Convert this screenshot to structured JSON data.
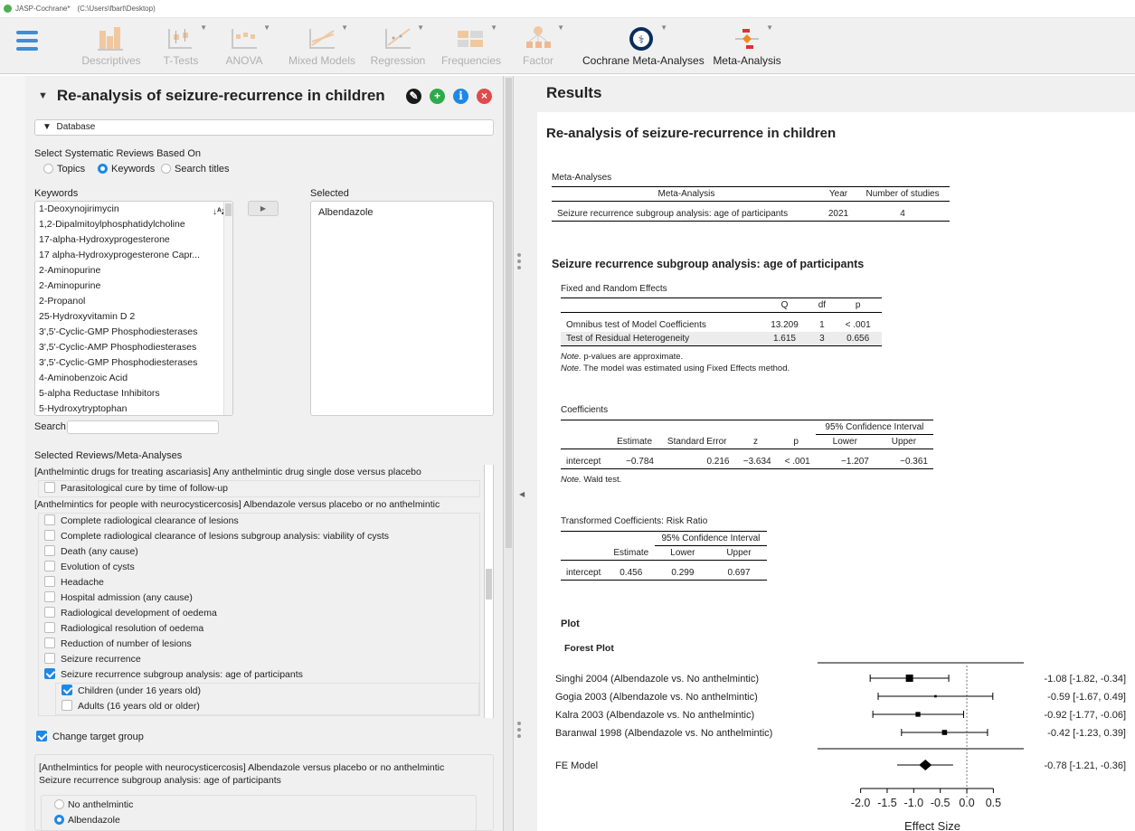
{
  "window": {
    "title": "JASP-Cochrane*",
    "path": "(C:\\Users\\fbart\\Desktop)"
  },
  "ribbon": {
    "modules": [
      {
        "label": "Descriptives",
        "active": false
      },
      {
        "label": "T-Tests",
        "active": false
      },
      {
        "label": "ANOVA",
        "active": false
      },
      {
        "label": "Mixed Models",
        "active": false
      },
      {
        "label": "Regression",
        "active": false
      },
      {
        "label": "Frequencies",
        "active": false
      },
      {
        "label": "Factor",
        "active": false
      },
      {
        "label": "Cochrane Meta-Analyses",
        "active": true
      },
      {
        "label": "Meta-Analysis",
        "active": true
      }
    ]
  },
  "analysis": {
    "title": "Re-analysis of seizure-recurrence in children",
    "database_label": "Database",
    "select_label": "Select Systematic Reviews Based On",
    "radio_options": [
      "Topics",
      "Keywords",
      "Search titles"
    ],
    "radio_selected": "Keywords",
    "keywords_label": "Keywords",
    "selected_label": "Selected",
    "keywords": [
      "1-Deoxynojirimycin",
      "1,2-Dipalmitoylphosphatidylcholine",
      "17-alpha-Hydroxyprogesterone",
      "17 alpha-Hydroxyprogesterone Capr...",
      "2-Aminopurine",
      "2-Aminopurine",
      "2-Propanol",
      "25-Hydroxyvitamin D 2",
      "3',5'-Cyclic-GMP Phosphodiesterases",
      "3',5'-Cyclic-AMP Phosphodiesterases",
      "3',5'-Cyclic-GMP Phosphodiesterases",
      "4-Aminobenzoic Acid",
      "5-alpha Reductase Inhibitors",
      "5-Hydroxytryptophan"
    ],
    "selected_keywords": [
      "Albendazole"
    ],
    "search_label": "Search",
    "reviews_label": "Selected Reviews/Meta-Analyses",
    "review1_header": "[Anthelmintic drugs for treating ascariasis] Any anthelmintic drug single dose versus placebo",
    "review1_items": [
      "Parasitological cure by time of follow-up"
    ],
    "review2_header": "[Anthelmintics for people with neurocysticercosis] Albendazole versus placebo or no anthelmintic",
    "review2_items": [
      {
        "label": "Complete radiological clearance of lesions",
        "checked": false
      },
      {
        "label": "Complete radiological clearance of lesions subgroup analysis: viability of cysts",
        "checked": false
      },
      {
        "label": "Death (any cause)",
        "checked": false
      },
      {
        "label": "Evolution of cysts",
        "checked": false
      },
      {
        "label": "Headache",
        "checked": false
      },
      {
        "label": "Hospital admission (any cause)",
        "checked": false
      },
      {
        "label": "Radiological development of oedema",
        "checked": false
      },
      {
        "label": "Radiological resolution of oedema",
        "checked": false
      },
      {
        "label": "Reduction of number of lesions",
        "checked": false
      },
      {
        "label": "Seizure recurrence",
        "checked": false
      },
      {
        "label": "Seizure recurrence subgroup analysis: age of participants",
        "checked": true
      }
    ],
    "subgroups": [
      {
        "label": "Children (under 16 years old)",
        "checked": true
      },
      {
        "label": "Adults (16 years old or older)",
        "checked": false
      }
    ],
    "change_target_label": "Change target group",
    "target_review": "[Anthelmintics for people with neurocysticercosis] Albendazole versus placebo or no anthelmintic",
    "target_outcome": "Seizure recurrence subgroup analysis: age of participants",
    "target_options": [
      "No anthelmintic",
      "Albendazole"
    ],
    "target_selected": "Albendazole"
  },
  "results": {
    "header": "Results",
    "title": "Re-analysis of seizure-recurrence in children",
    "ma_table": {
      "title": "Meta-Analyses",
      "headers": [
        "Meta-Analysis",
        "Year",
        "Number of studies"
      ],
      "row": [
        "Seizure recurrence subgroup analysis: age of participants",
        "2021",
        "4"
      ]
    },
    "section_title": "Seizure recurrence subgroup analysis: age of participants",
    "fre_table": {
      "title": "Fixed and Random Effects",
      "headers": [
        "",
        "Q",
        "df",
        "p"
      ],
      "rows": [
        [
          "Omnibus test of Model Coefficients",
          "13.209",
          "1",
          "< .001"
        ],
        [
          "Test of Residual Heterogeneity",
          "1.615",
          "3",
          "0.656"
        ]
      ],
      "note1_label": "Note.",
      "note1_rest": " p-values are approximate.",
      "note1_p": "p",
      "note2_label": "Note.",
      "note2_rest": " The model was estimated using Fixed Effects method."
    },
    "coef_table": {
      "title": "Coefficients",
      "ci_header": "95% Confidence Interval",
      "headers": [
        "",
        "Estimate",
        "Standard Error",
        "z",
        "p",
        "Lower",
        "Upper"
      ],
      "row": [
        "intercept",
        "−0.784",
        "0.216",
        "−3.634",
        "< .001",
        "−1.207",
        "−0.361"
      ],
      "note_label": "Note.",
      "note_rest": " Wald test."
    },
    "rr_table": {
      "title": "Transformed Coefficients: Risk Ratio",
      "ci_header": "95% Confidence Interval",
      "headers": [
        "",
        "Estimate",
        "Lower",
        "Upper"
      ],
      "row": [
        "intercept",
        "0.456",
        "0.299",
        "0.697"
      ]
    },
    "plot_section": "Plot",
    "forest_title": "Forest Plot"
  },
  "chart_data": {
    "type": "scatter",
    "subtype": "forest",
    "title": "Forest Plot",
    "xlabel": "Effect Size",
    "xlim": [
      -2.3,
      0.8
    ],
    "xticks": [
      "-2.0",
      "-1.5",
      "-1.0",
      "-0.5",
      "0.0",
      "0.5"
    ],
    "xtick_values": [
      -2.0,
      -1.5,
      -1.0,
      -0.5,
      0.0,
      0.5
    ],
    "reference_line": 0.0,
    "studies": [
      {
        "name": "Singhi 2004 (Albendazole vs. No anthelmintic)",
        "estimate": -1.08,
        "lower": -1.82,
        "upper": -0.34,
        "weight": 1.0,
        "label": "-1.08 [-1.82, -0.34]"
      },
      {
        "name": "Gogia 2003 (Albendazole vs. No anthelmintic)",
        "estimate": -0.59,
        "lower": -1.67,
        "upper": 0.49,
        "weight": 0.1,
        "label": "-0.59 [-1.67, 0.49]"
      },
      {
        "name": "Kalra 2003 (Albendazole vs. No anthelmintic)",
        "estimate": -0.92,
        "lower": -1.77,
        "upper": -0.06,
        "weight": 0.55,
        "label": "-0.92 [-1.77, -0.06]"
      },
      {
        "name": "Baranwal 1998 (Albendazole vs. No anthelmintic)",
        "estimate": -0.42,
        "lower": -1.23,
        "upper": 0.39,
        "weight": 0.6,
        "label": "-0.42 [-1.23, 0.39]"
      }
    ],
    "summary": {
      "name": "FE Model",
      "estimate": -0.78,
      "lower": -1.21,
      "upper": -0.36,
      "label": "-0.78 [-1.21, -0.36]"
    }
  },
  "colors": {
    "accent": "#1e88e5",
    "edit_btn": "#1a1a1a",
    "add_btn": "#2eaa4a",
    "info_btn": "#1e88e5",
    "close_btn": "#e04b4b"
  },
  "icons": {
    "edit": "pencil-icon",
    "add": "plus-icon",
    "info": "info-icon",
    "close": "close-icon"
  }
}
